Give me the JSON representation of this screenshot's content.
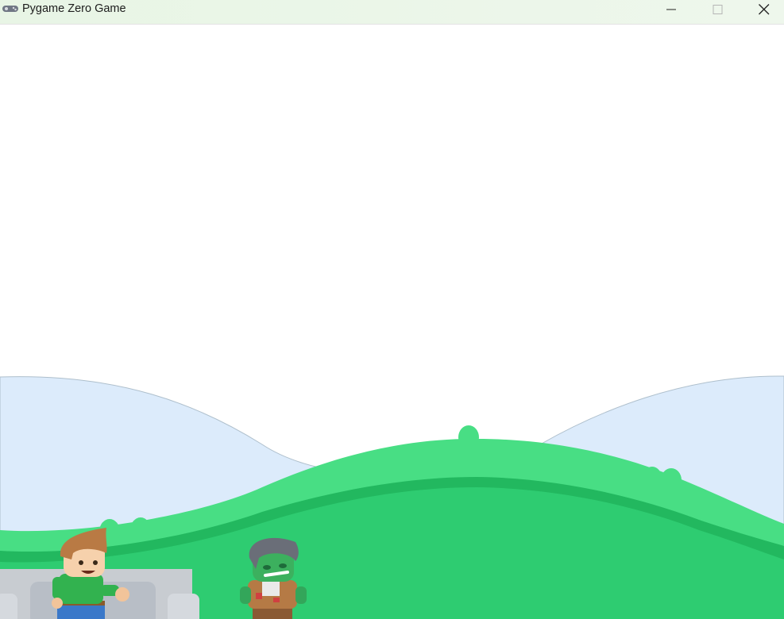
{
  "window": {
    "title": "Pygame Zero Game",
    "icon": "gamepad-icon",
    "controls": [
      "minimize-icon",
      "maximize-icon",
      "close-icon"
    ]
  },
  "scene": {
    "sky_color": "#ffffff",
    "far_hills_color": "#dcebfb",
    "near_hill_color": "#48de84",
    "ground_stripe_color": "#22b85f",
    "ground_color": "#2ecc71",
    "platform_color": "#c8ccd1",
    "player": "player-boy",
    "enemy": "zombie-enemy"
  }
}
